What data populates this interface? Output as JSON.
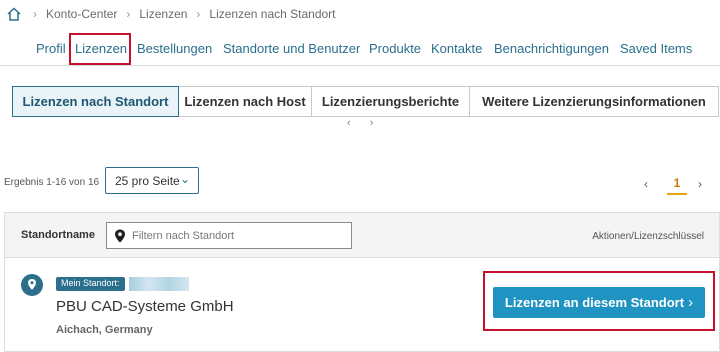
{
  "breadcrumb": {
    "items": [
      "Konto-Center",
      "Lizenzen",
      "Lizenzen nach Standort"
    ]
  },
  "nav": {
    "items": [
      "Profil",
      "Lizenzen",
      "Bestellungen",
      "Standorte und Benutzer",
      "Produkte",
      "Kontakte",
      "Benachrichtigungen",
      "Saved Items"
    ],
    "active_index": 1
  },
  "tabs": [
    {
      "label": "Lizenzen nach Standort",
      "active": true
    },
    {
      "label": "Lizenzen nach Host",
      "active": false
    },
    {
      "label": "Lizenzierungsberichte",
      "active": false
    },
    {
      "label": "Weitere Lizenzierungsinformationen",
      "active": false
    }
  ],
  "tab_arrows": "‹ ›",
  "results": {
    "text": "Ergebnis 1-16 von 16",
    "per_page": "25 pro Seite",
    "current_page": "1"
  },
  "table": {
    "column_name": "Standortname",
    "filter_placeholder": "Filtern nach Standort",
    "actions_label": "Aktionen/Lizenzschlüssel"
  },
  "site": {
    "badge": "Mein Standort:",
    "company": "PBU CAD-Systeme GmbH",
    "city": "Aichach, Germany",
    "button_label": "Lizenzen an diesem Standort"
  },
  "colors": {
    "accent": "#2b6f8c",
    "button": "#1f93c1",
    "highlight": "#c8102e",
    "page_active": "#e8a317"
  }
}
